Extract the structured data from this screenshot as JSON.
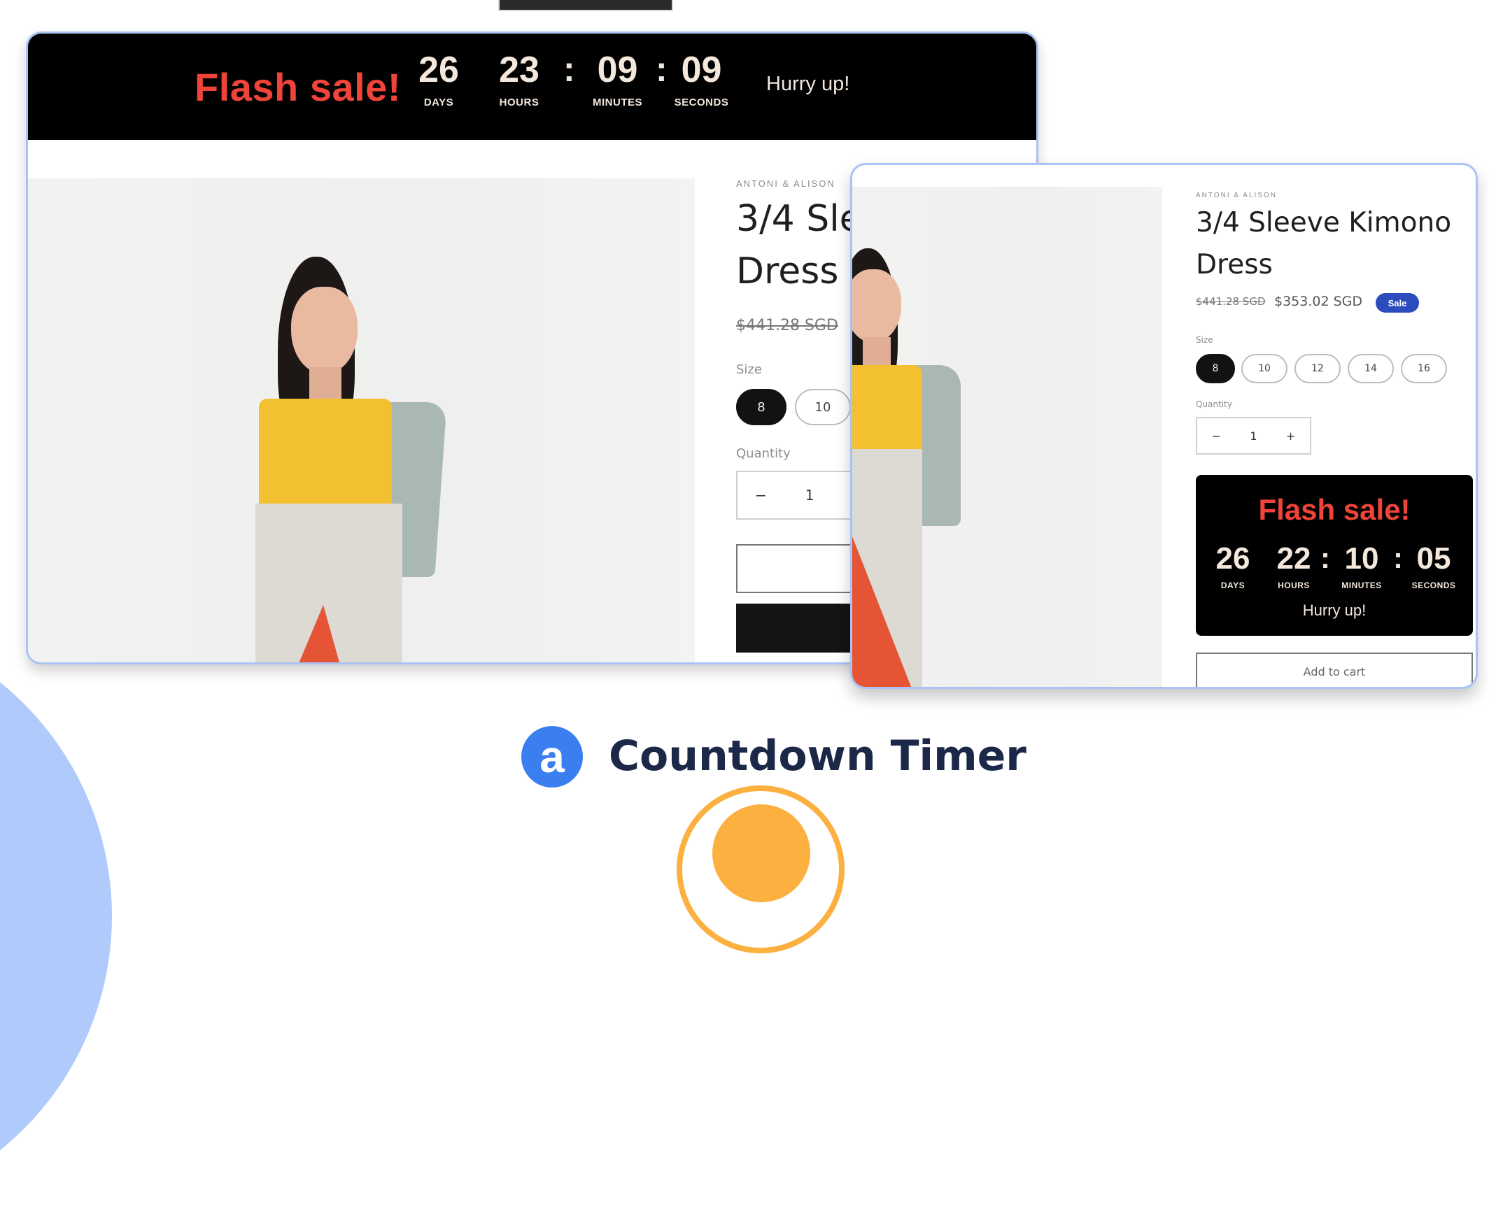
{
  "colors": {
    "flash_red": "#f0443a",
    "timer_text": "#f4e8dc",
    "sale_badge": "#2c4bbd",
    "brand_blue": "#3a7ef0",
    "card_border": "#a9c3f5",
    "logo_text": "#1b2847",
    "accent_orange": "#fbb040"
  },
  "desktop_preview": {
    "banner": {
      "title": "Flash sale!",
      "days": "26",
      "hours": "23",
      "minutes": "09",
      "seconds": "09",
      "labels": {
        "days": "DAYS",
        "hours": "HOURS",
        "minutes": "MINUTES",
        "seconds": "SECONDS"
      },
      "separator": ":",
      "subtitle": "Hurry up!"
    },
    "product": {
      "brand": "ANTONI & ALISON",
      "title_line1": "3/4 Sle",
      "title_line2": "Dress",
      "old_price": "$441.28 SGD",
      "size_label": "Size",
      "sizes": [
        "8",
        "10"
      ],
      "selected_size": "8",
      "quantity_label": "Quantity",
      "quantity_minus": "−",
      "quantity_value": "1"
    }
  },
  "mobile_preview": {
    "product": {
      "brand": "ANTONI & ALISON",
      "title_line1": "3/4 Sleeve Kimono",
      "title_line2": "Dress",
      "old_price": "$441.28 SGD",
      "price": "$353.02 SGD",
      "badge": "Sale",
      "size_label": "Size",
      "sizes": [
        "8",
        "10",
        "12",
        "14",
        "16"
      ],
      "selected_size": "8",
      "quantity_label": "Quantity",
      "quantity_minus": "−",
      "quantity_value": "1",
      "quantity_plus": "+",
      "add_to_cart": "Add to cart"
    },
    "timer": {
      "title": "Flash sale!",
      "days": "26",
      "hours": "22",
      "minutes": "10",
      "seconds": "05",
      "labels": {
        "days": "DAYS",
        "hours": "HOURS",
        "minutes": "MINUTES",
        "seconds": "SECONDS"
      },
      "separator": ":",
      "subtitle": "Hurry up!"
    }
  },
  "branding": {
    "logo_letter": "a",
    "app_name": "Countdown Timer"
  }
}
